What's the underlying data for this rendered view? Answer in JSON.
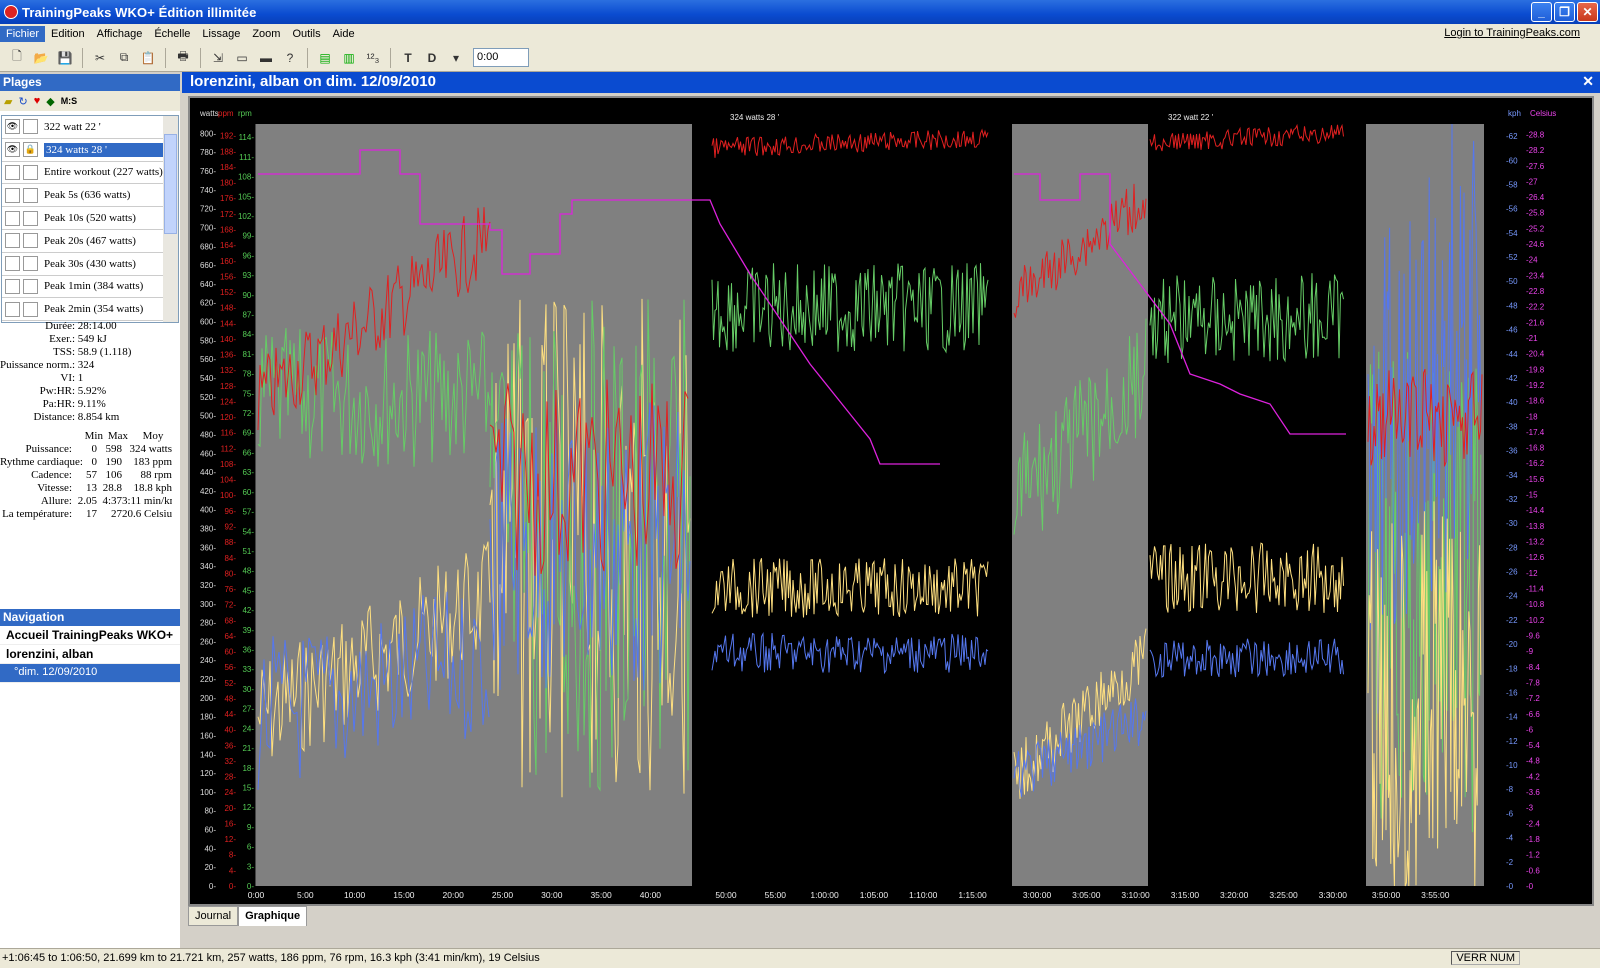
{
  "window": {
    "title": "TrainingPeaks WKO+ Édition illimitée"
  },
  "menu": {
    "items": [
      "Fichier",
      "Edition",
      "Affichage",
      "Échelle",
      "Lissage",
      "Zoom",
      "Outils",
      "Aide"
    ],
    "login": "Login to TrainingPeaks.com"
  },
  "toolbar": {
    "time_value": "0:00"
  },
  "plages": {
    "title": "Plages",
    "tools_ms": "M:S",
    "items": [
      "322 watt 22 '",
      "324 watts 28 '",
      "Entire workout (227 watts)",
      "Peak 5s (636 watts)",
      "Peak 10s (520 watts)",
      "Peak 20s (467 watts)",
      "Peak 30s (430 watts)",
      "Peak 1min (384 watts)",
      "Peak 2min (354 watts)"
    ]
  },
  "stats": {
    "summary": [
      {
        "k": "Durée",
        "v": ": 28:14.00"
      },
      {
        "k": "Exer.",
        "v": ": 549 kJ"
      },
      {
        "k": "TSS",
        "v": ": 58.9 (1.118)"
      },
      {
        "k": "Puissance norm.",
        "v": ": 324"
      },
      {
        "k": "VI",
        "v": ": 1"
      },
      {
        "k": "Pw:HR",
        "v": ": 5.92%"
      },
      {
        "k": "Pa:HR",
        "v": ": 9.11%"
      },
      {
        "k": "Distance",
        "v": ": 8.854 km"
      }
    ],
    "headers": [
      "Min",
      "Max",
      "Moy"
    ],
    "rows": [
      {
        "k": "Puissance:",
        "min": "0",
        "max": "598",
        "moy": "324 watts"
      },
      {
        "k": "Rythme cardiaque:",
        "min": "0",
        "max": "190",
        "moy": "183 ppm"
      },
      {
        "k": "Cadence:",
        "min": "57",
        "max": "106",
        "moy": "88 rpm"
      },
      {
        "k": "Vitesse:",
        "min": "13",
        "max": "28.8",
        "moy": "18.8 kph"
      },
      {
        "k": "Allure:",
        "min": "2.05",
        "max": "4:37",
        "moy": "3:11 min/km"
      },
      {
        "k": "La température:",
        "min": "17",
        "max": "27",
        "moy": "20.6 Celsius"
      }
    ]
  },
  "navigation": {
    "title": "Navigation",
    "items": [
      "Accueil TrainingPeaks WKO+",
      "lorenzini, alban",
      "°dim. 12/09/2010"
    ]
  },
  "document": {
    "title": "lorenzini, alban on dim. 12/09/2010"
  },
  "chart_data": {
    "type": "line",
    "axis_units": {
      "watts": "watts",
      "ppm": "ppm",
      "rpm": "rpm",
      "kph": "kph",
      "celsius": "Celsius"
    },
    "watts_ticks": [
      0,
      20,
      40,
      60,
      80,
      100,
      120,
      140,
      160,
      180,
      200,
      220,
      240,
      260,
      280,
      300,
      320,
      340,
      360,
      380,
      400,
      420,
      440,
      460,
      480,
      500,
      520,
      540,
      560,
      580,
      600,
      620,
      640,
      660,
      680,
      700,
      720,
      740,
      760,
      780,
      800
    ],
    "ppm_ticks": [
      0,
      4,
      8,
      12,
      16,
      20,
      24,
      28,
      32,
      36,
      40,
      44,
      48,
      52,
      56,
      60,
      64,
      68,
      72,
      76,
      80,
      84,
      88,
      92,
      96,
      100,
      104,
      108,
      112,
      116,
      120,
      124,
      128,
      132,
      136,
      140,
      144,
      148,
      152,
      156,
      160,
      164,
      168,
      172,
      176,
      180,
      184,
      188,
      192
    ],
    "rpm_ticks": [
      0,
      3,
      6,
      9,
      12,
      15,
      18,
      21,
      24,
      27,
      30,
      33,
      36,
      39,
      42,
      45,
      48,
      51,
      54,
      57,
      60,
      63,
      66,
      69,
      72,
      75,
      78,
      81,
      84,
      87,
      90,
      93,
      96,
      99,
      102,
      105,
      108,
      111,
      114
    ],
    "kph_ticks": [
      0,
      2,
      4,
      6,
      8,
      10,
      12,
      14,
      16,
      18,
      20,
      22,
      24,
      26,
      28,
      30,
      32,
      34,
      36,
      38,
      40,
      42,
      44,
      46,
      48,
      50,
      52,
      54,
      56,
      58,
      60,
      62
    ],
    "celsius_ticks": [
      "0",
      "0.6",
      "1.2",
      "1.8",
      "2.4",
      "3",
      "3.6",
      "4.2",
      "4.8",
      "5.4",
      "6",
      "6.6",
      "7.2",
      "7.8",
      "8.4",
      "9",
      "9.6",
      "10.2",
      "10.8",
      "11.4",
      "12",
      "12.6",
      "13.2",
      "13.8",
      "14.4",
      "15",
      "15.6",
      "16.2",
      "16.8",
      "17.4",
      "18",
      "18.6",
      "19.2",
      "19.8",
      "20.4",
      "21",
      "21.6",
      "22.2",
      "22.8",
      "23.4",
      "24",
      "24.6",
      "25.2",
      "25.8",
      "26.4",
      "27",
      "27.6",
      "28.2",
      "28.8"
    ],
    "time_ticks": [
      [
        "0:00",
        "5:00",
        "10:00",
        "15:00",
        "20:00",
        "25:00",
        "30:00",
        "35:00",
        "40:00"
      ],
      [
        "50:00",
        "55:00",
        "1:00:00",
        "1:05:00",
        "1:10:00",
        "1:15:00"
      ],
      [
        "3:00:00",
        "3:05:00",
        "3:10:00",
        "3:15:00",
        "3:20:00",
        "3:25:00",
        "3:30:00"
      ],
      [
        "3:50:00",
        "3:55:00"
      ]
    ],
    "range_labels": [
      "324 watts 28 '",
      "322 watt 22 '"
    ],
    "series": [
      {
        "name": "watts",
        "color": "#ffe080"
      },
      {
        "name": "ppm",
        "color": "#e02020"
      },
      {
        "name": "rpm",
        "color": "#66cc66"
      },
      {
        "name": "kph",
        "color": "#5577ee"
      },
      {
        "name": "Celsius",
        "color": "#dd22dd"
      }
    ]
  },
  "tabs": [
    "Journal",
    "Graphique"
  ],
  "status": {
    "text": "+1:06:45 to 1:06:50, 21.699 km to 21.721 km, 257 watts, 186 ppm, 76 rpm, 16.3 kph (3:41 min/km), 19 Celsius",
    "indicator": "VERR NUM"
  }
}
